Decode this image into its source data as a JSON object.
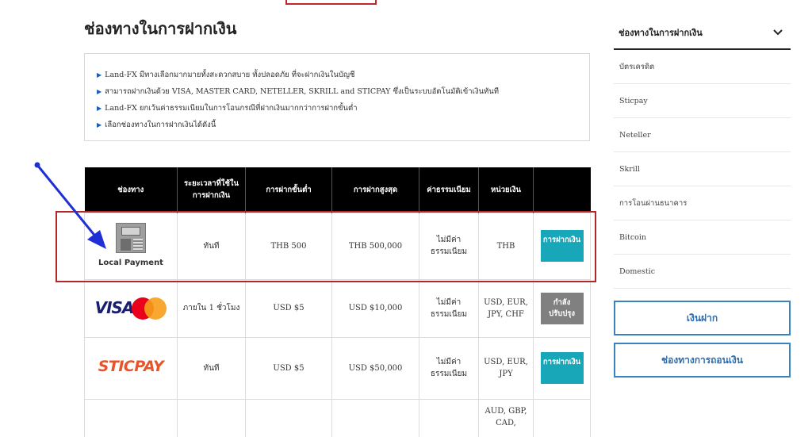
{
  "page": {
    "title": "ช่องทางในการฝากเงิน"
  },
  "info": {
    "lines": [
      "Land-FX มีทางเลือกมากมายทั้งสะดวกสบาย ทั้งปลอดภัย ที่จะฝากเงินในบัญชี",
      "สามารถฝากเงินด้วย VISA, MASTER CARD, NETELLER, SKRILL and STICPAY ซึ่งเป็นระบบอัตโนมัติเข้าเงินทันที",
      "Land-FX ยกเว้นค่าธรรมเนียมในการโอนกรณีที่ฝากเงินมากกว่าการฝากขั้นต่ำ",
      "เลือกช่องทางในการฝากเงินได้ดังนี้"
    ]
  },
  "table": {
    "headers": [
      "ช่องทาง",
      "ระยะเวลาที่ใช้ในการฝากเงิน",
      "การฝากขั้นต่ำ",
      "การฝากสูงสุด",
      "ค่าธรรมเนียม",
      "หน่วยเงิน",
      ""
    ],
    "rows": [
      {
        "channel_label": "Local Payment",
        "time": "ทันที",
        "min": "THB 500",
        "max": "THB 500,000",
        "fee": "ไม่มีค่าธรรมเนียม",
        "currency": "THB",
        "action": "การฝากเงิน"
      },
      {
        "channel_label": "VISA",
        "time": "ภายใน 1 ชั่วโมง",
        "min": "USD $5",
        "max": "USD $10,000",
        "fee": "ไม่มีค่าธรรมเนียม",
        "currency": "USD, EUR, JPY, CHF",
        "action": "กำลังปรับปรุง"
      },
      {
        "channel_label": "STICPAY",
        "time": "ทันที",
        "min": "USD $5",
        "max": "USD $50,000",
        "fee": "ไม่มีค่าธรรมเนียม",
        "currency": "USD, EUR, JPY",
        "action": "การฝากเงิน"
      },
      {
        "channel_label": "",
        "time": "",
        "min": "",
        "max": "",
        "fee": "",
        "currency": "AUD, GBP, CAD,",
        "action": ""
      }
    ]
  },
  "sidebar": {
    "title": "ช่องทางในการฝากเงิน",
    "items": [
      "บัตรเครดิต",
      "Sticpay",
      "Neteller",
      "Skrill",
      "การโอนผ่านธนาคาร",
      "Bitcoin",
      "Domestic"
    ],
    "deposit_button": "เงินฝาก",
    "withdraw_button": "ช่องทางการถอนเงิน"
  },
  "colors": {
    "accent_teal": "#17a7b8",
    "highlight_red": "#b5262b",
    "arrow_blue": "#1f2fd6",
    "sidebar_button_blue": "#3a83c2"
  },
  "icons": [
    "atm-icon",
    "visa-logo",
    "mastercard-logo",
    "sticpay-logo",
    "chevron-down-icon",
    "triangle-bullet-icon",
    "arrow-annotation"
  ]
}
